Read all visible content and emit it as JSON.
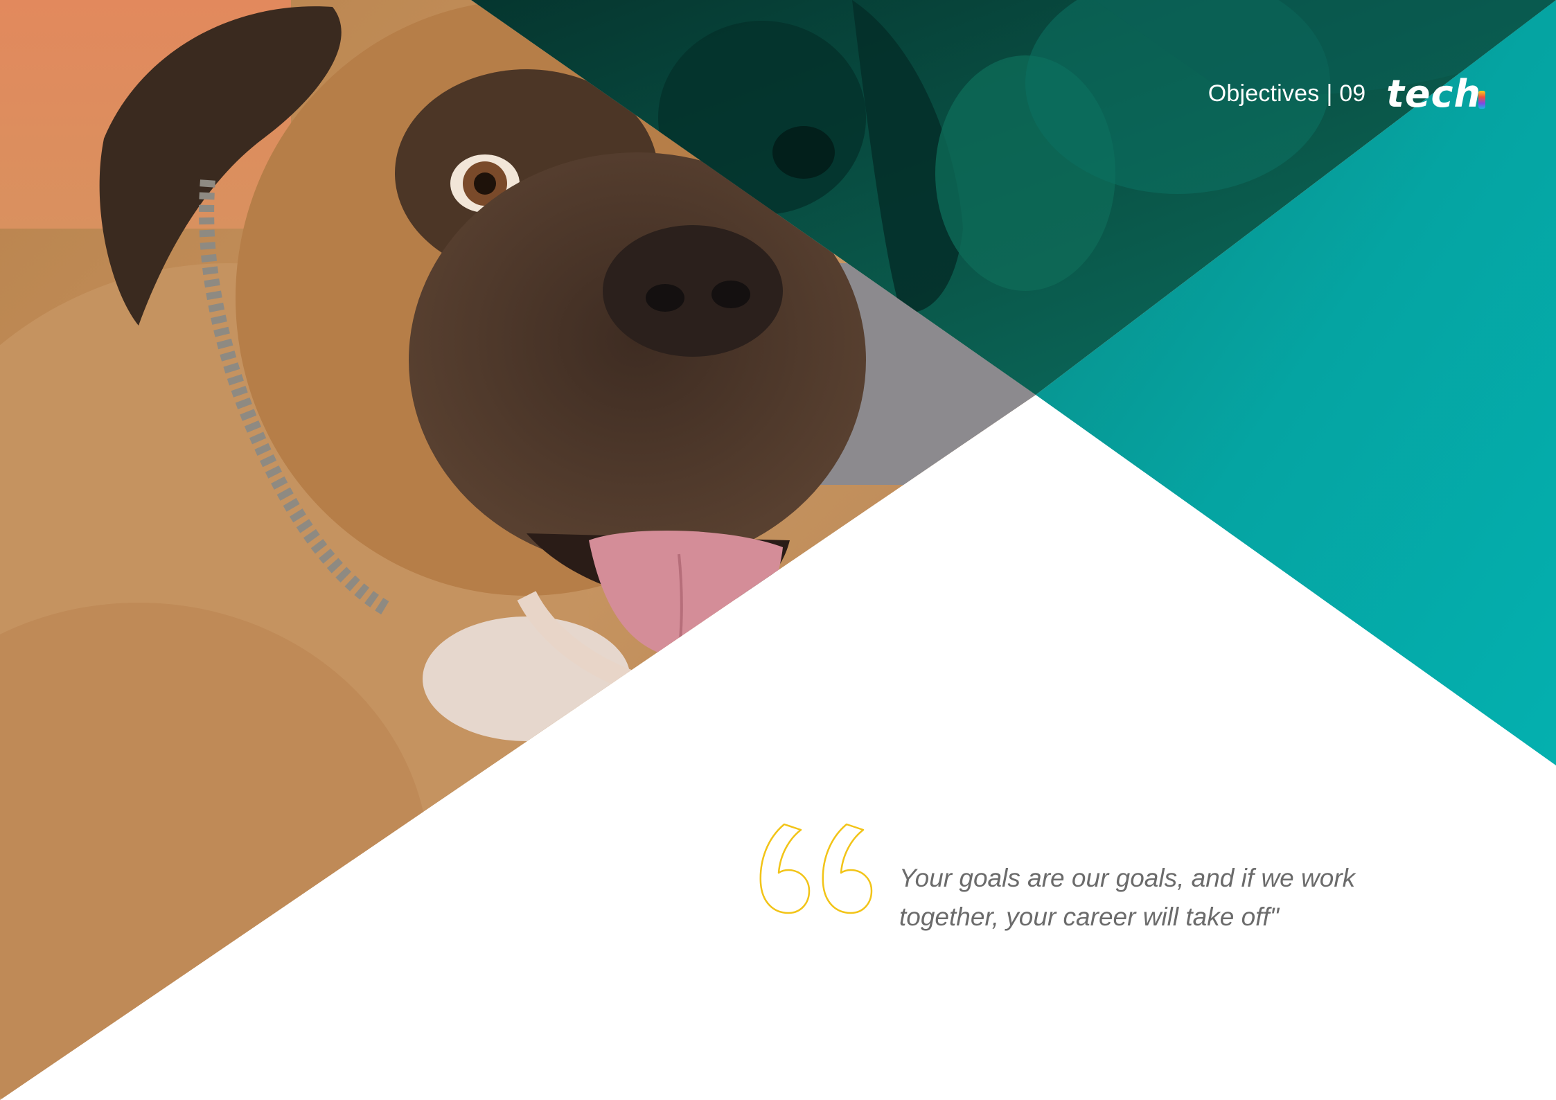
{
  "header": {
    "section": "Objectives",
    "separator": "|",
    "page_number": "09",
    "logo_text": "tech"
  },
  "quote": {
    "text": "Your goals are our goals, and if we work\ntogether, your career will take off\""
  },
  "colors": {
    "teal": "#06a8a8",
    "teal_dark": "#0b5d4f",
    "quote_mark": "#f2c418",
    "quote_text": "#6b6b6b",
    "photo_tone": "#c48a52"
  },
  "image": {
    "subject": "dog-photo",
    "icon": "quote-open-icon"
  }
}
